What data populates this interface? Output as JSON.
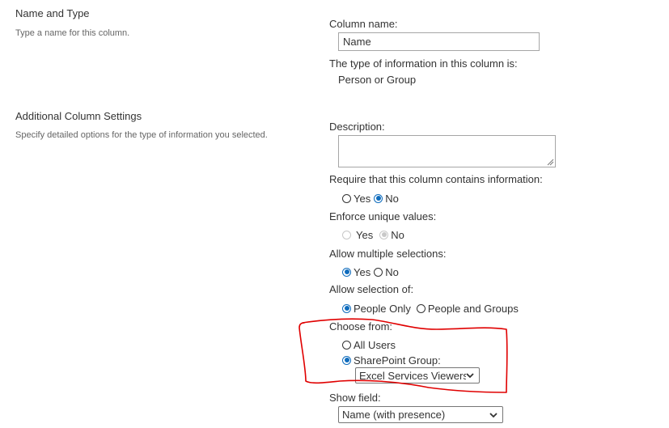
{
  "sections": {
    "name_type": {
      "title": "Name and Type",
      "description": "Type a name for this column."
    },
    "additional": {
      "title": "Additional Column Settings",
      "description": "Specify detailed options for the type of information you selected."
    }
  },
  "column_name": {
    "label": "Column name:",
    "value": "Name"
  },
  "type_info": {
    "label": "The type of information in this column is:",
    "value": "Person or Group"
  },
  "description": {
    "label": "Description:",
    "value": ""
  },
  "require": {
    "label": "Require that this column contains information:",
    "options": [
      "Yes",
      "No"
    ],
    "selected": "No"
  },
  "unique": {
    "label": "Enforce unique values:",
    "options": [
      "Yes",
      "No"
    ],
    "selected": "No",
    "disabled": true
  },
  "multiple": {
    "label": "Allow multiple selections:",
    "options": [
      "Yes",
      "No"
    ],
    "selected": "Yes"
  },
  "selection_of": {
    "label": "Allow selection of:",
    "options": [
      "People Only",
      "People and Groups"
    ],
    "selected": "People Only"
  },
  "choose_from": {
    "label": "Choose from:",
    "options": [
      "All Users",
      "SharePoint Group:"
    ],
    "selected": "SharePoint Group:",
    "group_select": "Excel Services Viewers"
  },
  "show_field": {
    "label": "Show field:",
    "value": "Name (with presence)"
  },
  "colors": {
    "accent": "#0f6cbd",
    "annotation": "#e00000"
  },
  "icons": {
    "dropdown": "chevron-down-icon",
    "resize": "resize-grip-icon"
  }
}
